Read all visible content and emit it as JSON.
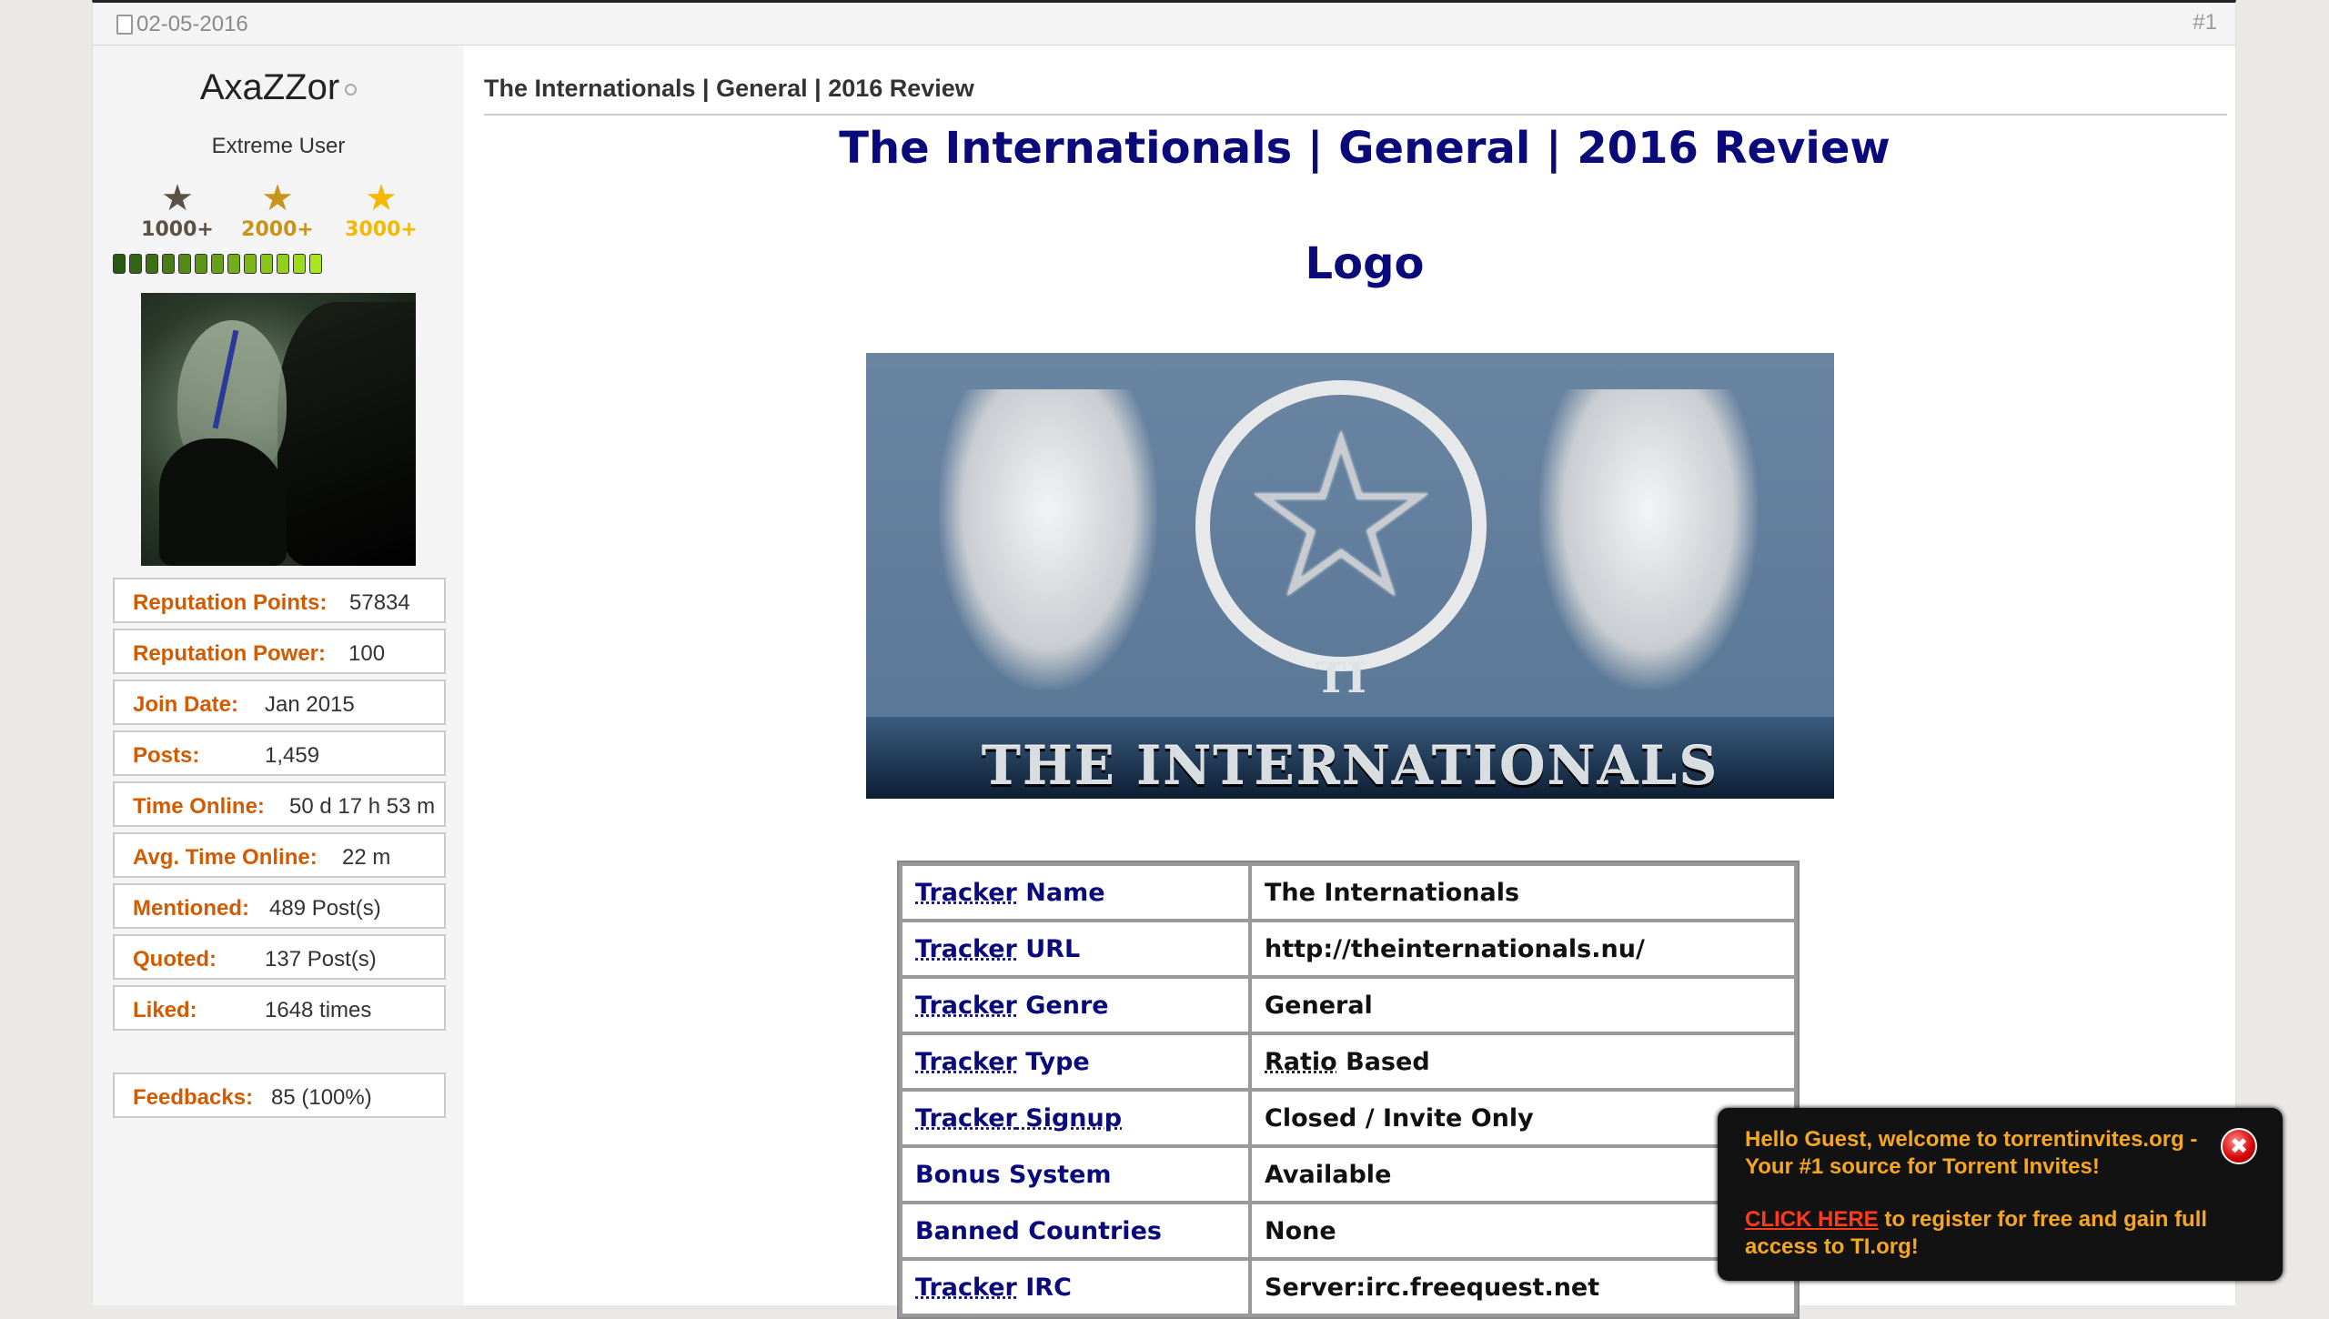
{
  "post": {
    "date": "02-05-2016",
    "number": "#1"
  },
  "user": {
    "name": "AxaZZor",
    "title": "Extreme User",
    "awards": [
      {
        "label": "1000+",
        "color": "#5a5044"
      },
      {
        "label": "2000+",
        "color": "#c8941a"
      },
      {
        "label": "3000+",
        "color": "#f5b800"
      }
    ],
    "rep_segments": 13,
    "stats": [
      {
        "label": "Reputation Points:",
        "value": "57834"
      },
      {
        "label": "Reputation Power:",
        "value": "100"
      },
      {
        "label": "Join Date:",
        "value": "Jan 2015"
      },
      {
        "label": "Posts:",
        "value": "1,459"
      },
      {
        "label": "Time Online:",
        "value": "50 d 17 h 53 m"
      },
      {
        "label": "Avg. Time Online:",
        "value": "22 m"
      },
      {
        "label": "Mentioned:",
        "value": "489 Post(s)"
      },
      {
        "label": "Quoted:",
        "value": "137 Post(s)"
      },
      {
        "label": "Liked:",
        "value": "1648 times"
      }
    ],
    "feedback": {
      "label": "Feedbacks:",
      "value": "85 (100%)"
    }
  },
  "content": {
    "post_title": "The Internationals | General | 2016 Review",
    "heading": "The Internationals | General | 2016 Review",
    "logo_heading": "Logo",
    "logo_banner": "THE INTERNATIONALS",
    "logo_ti": "TI",
    "table": [
      {
        "k1": "Tracker",
        "k2": " Name",
        "v1": "",
        "v2": "The Internationals"
      },
      {
        "k1": "Tracker",
        "k2": " URL",
        "v1": "",
        "v2": "http://theinternationals.nu/"
      },
      {
        "k1": "Tracker",
        "k2": " Genre",
        "v1": "",
        "v2": "General"
      },
      {
        "k1": "Tracker",
        "k2": " Type",
        "v1": "Ratio",
        "v2": " Based"
      },
      {
        "k1": "Tracker",
        "k2": " Signup",
        "v1": "",
        "v2": "Closed / Invite Only"
      },
      {
        "k1": "",
        "k2": "Bonus System",
        "v1": "",
        "v2": "Available"
      },
      {
        "k1": "",
        "k2": "Banned Countries",
        "v1": "",
        "v2": "None"
      },
      {
        "k1": "Tracker",
        "k2": " IRC",
        "v1": "",
        "v2": "Server:irc.freequest.net"
      }
    ]
  },
  "popup": {
    "line1": "Hello Guest, welcome to torrentinvites.org - Your #1 source for Torrent Invites!",
    "link": "CLICK HERE",
    "line2": " to register for free and gain full access to TI.org!",
    "close": "✖"
  }
}
